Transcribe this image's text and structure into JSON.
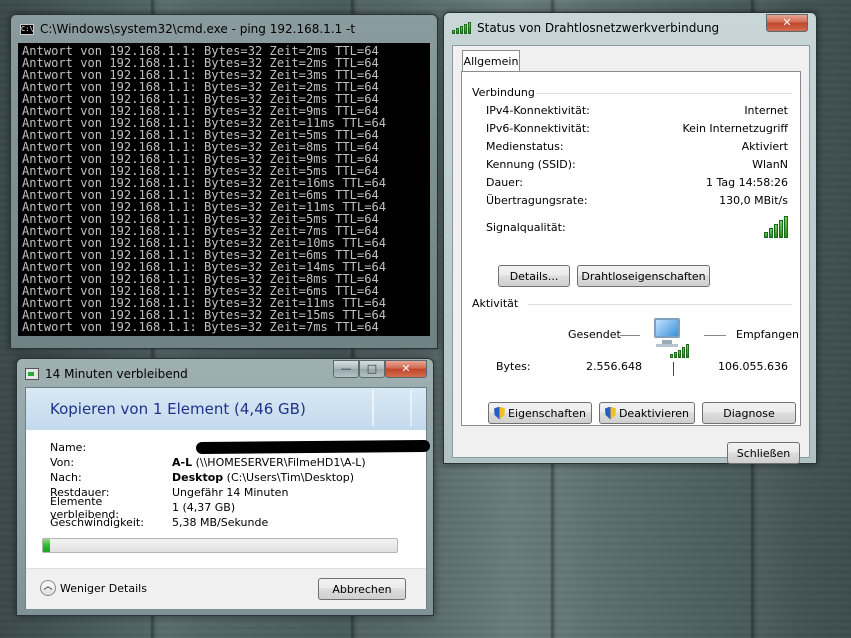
{
  "cmd": {
    "title": "C:\\Windows\\system32\\cmd.exe - ping  192.168.1.1 -t",
    "icon_text": "C:\\",
    "lines": [
      "Antwort von 192.168.1.1: Bytes=32 Zeit=2ms TTL=64",
      "Antwort von 192.168.1.1: Bytes=32 Zeit=2ms TTL=64",
      "Antwort von 192.168.1.1: Bytes=32 Zeit=3ms TTL=64",
      "Antwort von 192.168.1.1: Bytes=32 Zeit=2ms TTL=64",
      "Antwort von 192.168.1.1: Bytes=32 Zeit=2ms TTL=64",
      "Antwort von 192.168.1.1: Bytes=32 Zeit=9ms TTL=64",
      "Antwort von 192.168.1.1: Bytes=32 Zeit=11ms TTL=64",
      "Antwort von 192.168.1.1: Bytes=32 Zeit=5ms TTL=64",
      "Antwort von 192.168.1.1: Bytes=32 Zeit=8ms TTL=64",
      "Antwort von 192.168.1.1: Bytes=32 Zeit=9ms TTL=64",
      "Antwort von 192.168.1.1: Bytes=32 Zeit=5ms TTL=64",
      "Antwort von 192.168.1.1: Bytes=32 Zeit=16ms TTL=64",
      "Antwort von 192.168.1.1: Bytes=32 Zeit=6ms TTL=64",
      "Antwort von 192.168.1.1: Bytes=32 Zeit=11ms TTL=64",
      "Antwort von 192.168.1.1: Bytes=32 Zeit=5ms TTL=64",
      "Antwort von 192.168.1.1: Bytes=32 Zeit=7ms TTL=64",
      "Antwort von 192.168.1.1: Bytes=32 Zeit=10ms TTL=64",
      "Antwort von 192.168.1.1: Bytes=32 Zeit=6ms TTL=64",
      "Antwort von 192.168.1.1: Bytes=32 Zeit=14ms TTL=64",
      "Antwort von 192.168.1.1: Bytes=32 Zeit=8ms TTL=64",
      "Antwort von 192.168.1.1: Bytes=32 Zeit=6ms TTL=64",
      "Antwort von 192.168.1.1: Bytes=32 Zeit=11ms TTL=64",
      "Antwort von 192.168.1.1: Bytes=32 Zeit=15ms TTL=64",
      "Antwort von 192.168.1.1: Bytes=32 Zeit=7ms TTL=64"
    ]
  },
  "copy": {
    "title": "14 Minuten verbleibend",
    "header": "Kopieren von 1 Element (4,46 GB)",
    "rows": {
      "name_label": "Name:",
      "von_label": "Von:",
      "von_bold": "A-L",
      "von_rest": " (\\\\HOMESERVER\\FilmeHD1\\A-L)",
      "nach_label": "Nach:",
      "nach_bold": "Desktop",
      "nach_rest": " (C:\\Users\\Tim\\Desktop)",
      "rest_label": "Restdauer:",
      "rest_value": "Ungefähr 14 Minuten",
      "elem_label": "Elemente verbleibend:",
      "elem_value": "1 (4,37 GB)",
      "speed_label": "Geschwindigkeit:",
      "speed_value": "5,38 MB/Sekunde"
    },
    "progress": 0.02,
    "less_details": "Weniger Details",
    "cancel": "Abbrechen",
    "minimize": "—",
    "maximize": "□",
    "close": "✕"
  },
  "wlan": {
    "title": "Status von Drahtlosnetzwerkverbindung",
    "close": "✕",
    "tab": "Allgemein",
    "verbindung": "Verbindung",
    "fields": [
      {
        "label": "IPv4-Konnektivität:",
        "value": "Internet"
      },
      {
        "label": "IPv6-Konnektivität:",
        "value": "Kein Internetzugriff"
      },
      {
        "label": "Medienstatus:",
        "value": "Aktiviert"
      },
      {
        "label": "Kennung (SSID):",
        "value": "WlanN"
      },
      {
        "label": "Dauer:",
        "value": "1 Tag 14:58:26"
      },
      {
        "label": "Übertragungsrate:",
        "value": "130,0 MBit/s"
      }
    ],
    "signal_label": "Signalqualität:",
    "signal_bars": 5,
    "details_btn": "Details...",
    "wireless_props_btn": "Drahtloseigenschaften",
    "aktivitaet": "Aktivität",
    "gesendet": "Gesendet",
    "empfangen": "Empfangen",
    "bytes_label": "Bytes:",
    "bytes_sent": "2.556.648",
    "bytes_received": "106.055.636",
    "eigenschaften_btn": "Eigenschaften",
    "deaktivieren_btn": "Deaktivieren",
    "diagnose_btn": "Diagnose",
    "schliessen_btn": "Schließen"
  }
}
